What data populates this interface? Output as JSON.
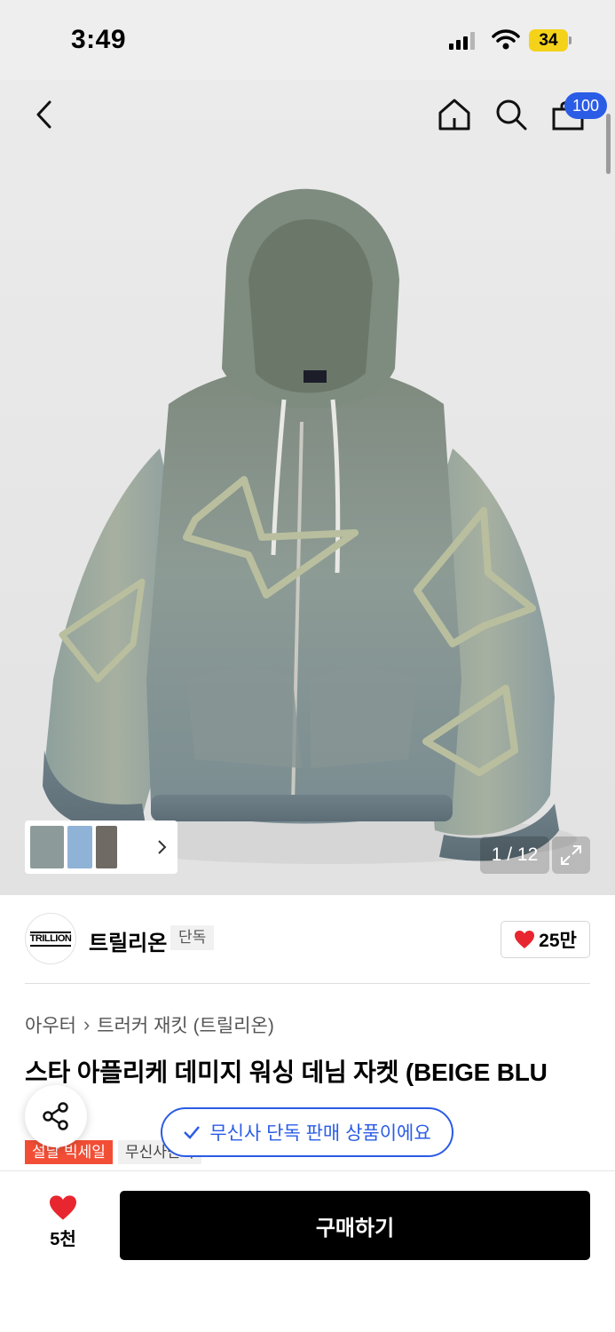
{
  "status_bar": {
    "time": "3:49",
    "battery": "34"
  },
  "nav": {
    "cart_count": "100"
  },
  "gallery": {
    "counter": "1 / 12"
  },
  "brand": {
    "logo_text": "TRILLION",
    "name": "트릴리온",
    "tag": "단독",
    "likes": "25만"
  },
  "breadcrumb": {
    "category": "아우터",
    "subcategory": "트러커 재킷 (트릴리온)"
  },
  "product": {
    "title": "스타 아플리케 데미지 워싱 데님 자켓 (BEIGE BLU"
  },
  "exclusive_notice": "무신사 단독 판매 상품이에요",
  "tags": [
    "설날 빅세일",
    "무신사단독"
  ],
  "bottom_bar": {
    "wish_count": "5천",
    "buy_label": "구매하기"
  },
  "colors": {
    "accent_blue": "#2b5ce6",
    "sale_red": "#f24e35",
    "heart_red": "#e8262f",
    "battery_yellow": "#f5d21a"
  }
}
